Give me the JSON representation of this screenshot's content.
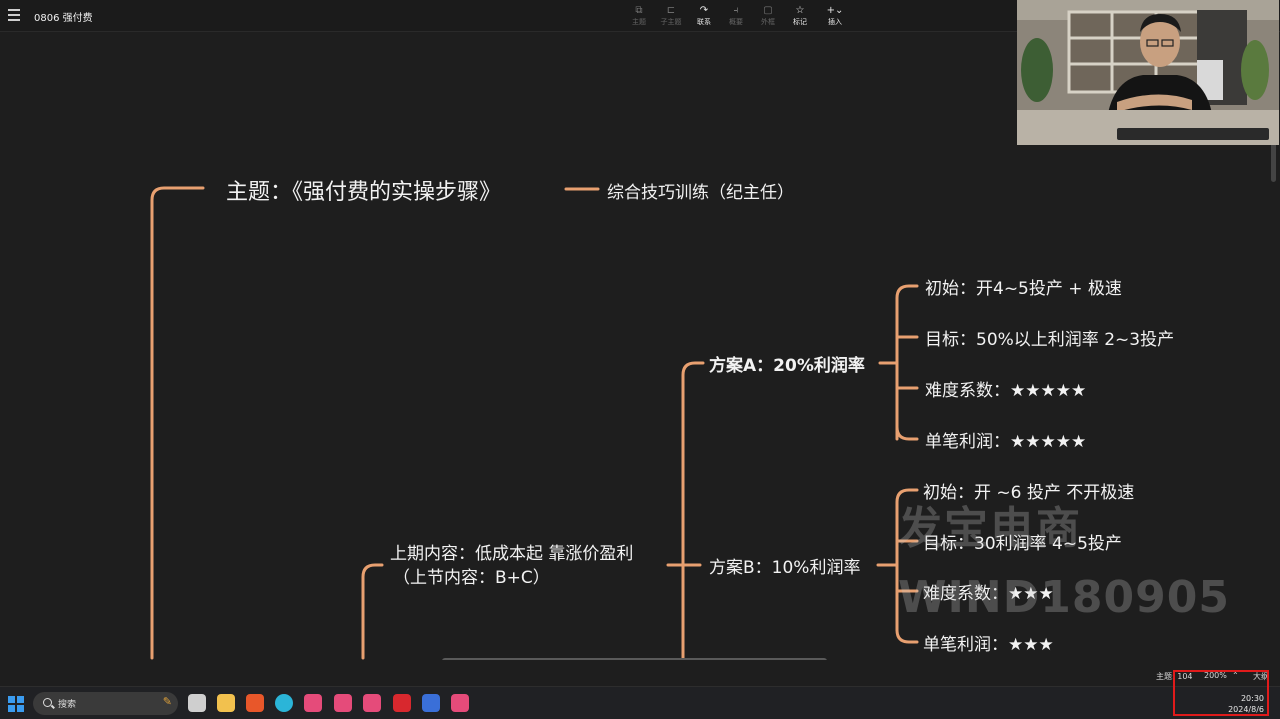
{
  "app": {
    "doc_title": "0806 强付费"
  },
  "toolbar": {
    "items": [
      {
        "label": "主题",
        "icon": "topic-icon",
        "active": false
      },
      {
        "label": "子主题",
        "icon": "subtopic-icon",
        "active": false
      },
      {
        "label": "联系",
        "icon": "relationship-icon",
        "active": true
      },
      {
        "label": "概要",
        "icon": "summary-icon",
        "active": false
      },
      {
        "label": "外框",
        "icon": "boundary-icon",
        "active": false
      },
      {
        "label": "标记",
        "icon": "marker-star-icon",
        "active": true
      },
      {
        "label": "插入",
        "icon": "insert-plus-icon",
        "active": true
      }
    ]
  },
  "mindmap": {
    "root": "主题：《强付费的实操步骤》",
    "root_sibling": "综合技巧训练（纪主任）",
    "prev": {
      "line1": "上期内容：低成本起 靠涨价盈利",
      "line2": "（上节内容：B+C）"
    },
    "plan_a": {
      "label": "方案A：20%利润率",
      "children": [
        "初始：开4~5投产 + 极速",
        "目标：50%以上利润率  2~3投产",
        "难度系数：★★★★★",
        "单笔利润：★★★★★"
      ]
    },
    "plan_b": {
      "label": "方案B：10%利润率",
      "children": [
        "初始：开 ~6 投产 不开极速",
        "目标：30利润率  4~5投产",
        "难度系数：★★★",
        "单笔利润：★★★"
      ]
    }
  },
  "watermark": {
    "line1": "发宝电商",
    "line2": "WIND180905"
  },
  "status": {
    "topic_count_label": "主题: 104",
    "zoom": "200%",
    "outline_label": "大纲"
  },
  "taskbar": {
    "search_label": "搜索",
    "time": "20:30",
    "date": "2024/8/6",
    "apps": [
      {
        "name": "task-view-icon",
        "color": "#cfcfcf"
      },
      {
        "name": "file-explorer-icon",
        "color": "#f2c14e"
      },
      {
        "name": "xmind-icon",
        "color": "#e8572a"
      },
      {
        "name": "edge-icon",
        "color": "#2bb5d8"
      },
      {
        "name": "app-pink-1-icon",
        "color": "#e54b7a"
      },
      {
        "name": "app-pink-2-icon",
        "color": "#e54b7a"
      },
      {
        "name": "app-pink-3-icon",
        "color": "#e54b7a"
      },
      {
        "name": "wps-icon",
        "color": "#d8282e"
      },
      {
        "name": "screen-recorder-icon",
        "color": "#3a6fd8"
      },
      {
        "name": "app-pink-4-icon",
        "color": "#e54b7a"
      }
    ]
  },
  "colors": {
    "branch": "#e8a070",
    "background": "#1e1e1e"
  }
}
